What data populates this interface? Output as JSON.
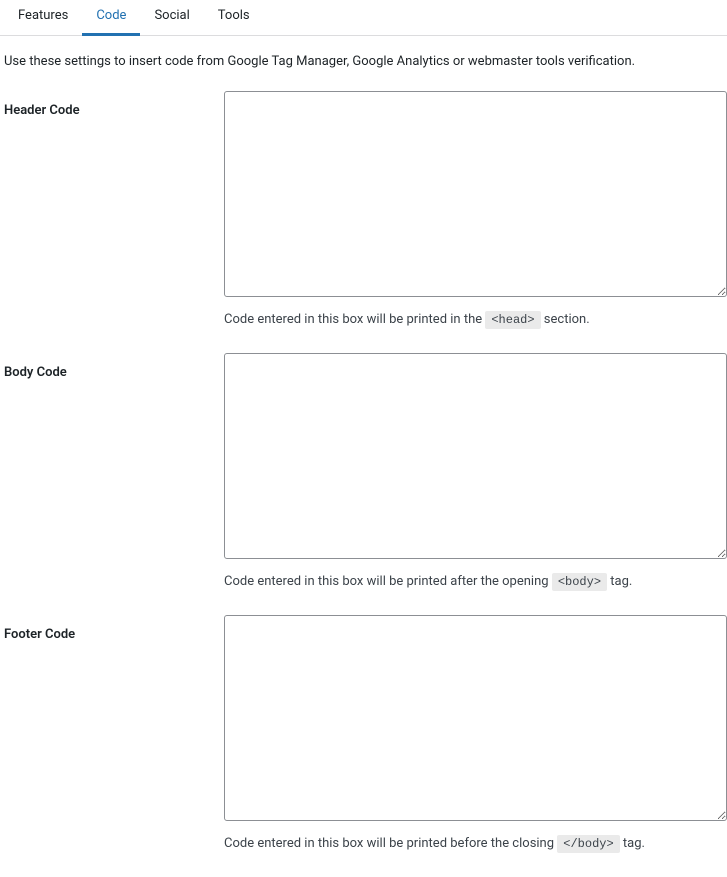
{
  "tabs": [
    {
      "label": "Features",
      "active": false
    },
    {
      "label": "Code",
      "active": true
    },
    {
      "label": "Social",
      "active": false
    },
    {
      "label": "Tools",
      "active": false
    }
  ],
  "intro": "Use these settings to insert code from Google Tag Manager, Google Analytics or webmaster tools verification.",
  "fields": {
    "header": {
      "label": "Header Code",
      "value": "",
      "help_pre": "Code entered in this box will be printed in the ",
      "help_tag": "<head>",
      "help_post": " section."
    },
    "body": {
      "label": "Body Code",
      "value": "",
      "help_pre": "Code entered in this box will be printed after the opening ",
      "help_tag": "<body>",
      "help_post": " tag."
    },
    "footer": {
      "label": "Footer Code",
      "value": "",
      "help_pre": "Code entered in this box will be printed before the closing ",
      "help_tag": "</body>",
      "help_post": " tag."
    }
  }
}
